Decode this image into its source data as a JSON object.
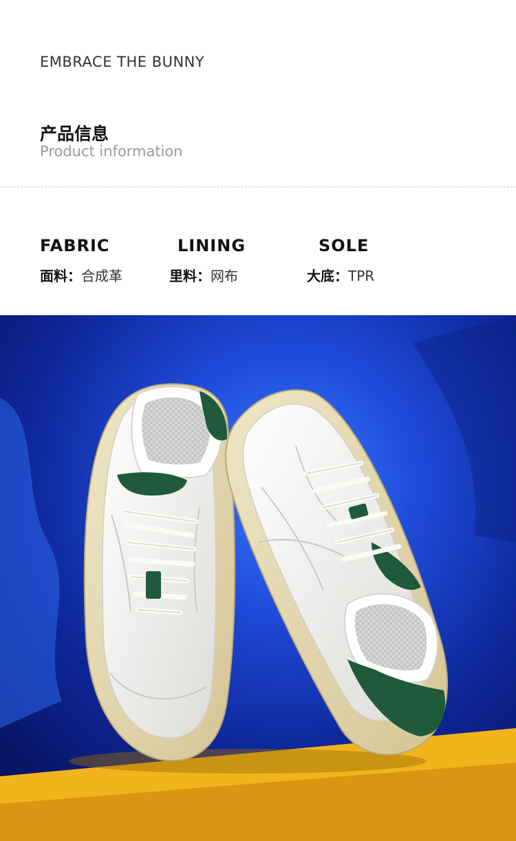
{
  "header": {
    "brand": "EMBRACE THE BUNNY",
    "title_zh": "产品信息",
    "title_en": "Product information"
  },
  "specs": [
    {
      "heading": "FABRIC",
      "key": "面料：",
      "value": "合成革"
    },
    {
      "heading": "LINING",
      "key": "里料：",
      "value": "网布"
    },
    {
      "heading": "SOLE",
      "key": "大底：",
      "value": "TPR"
    }
  ],
  "photo": {
    "subject": "pair-of-white-sneakers-with-green-heel-tabs",
    "colors": {
      "backdrop": "#0d2aa3",
      "spotlight": "#2a63e6",
      "platform_top": "#f2b41d",
      "platform_front": "#d68f0a",
      "shoe_upper": "#f4f3ef",
      "shoe_sole": "#e8dcb6",
      "accent_green": "#1f5a3a"
    }
  }
}
